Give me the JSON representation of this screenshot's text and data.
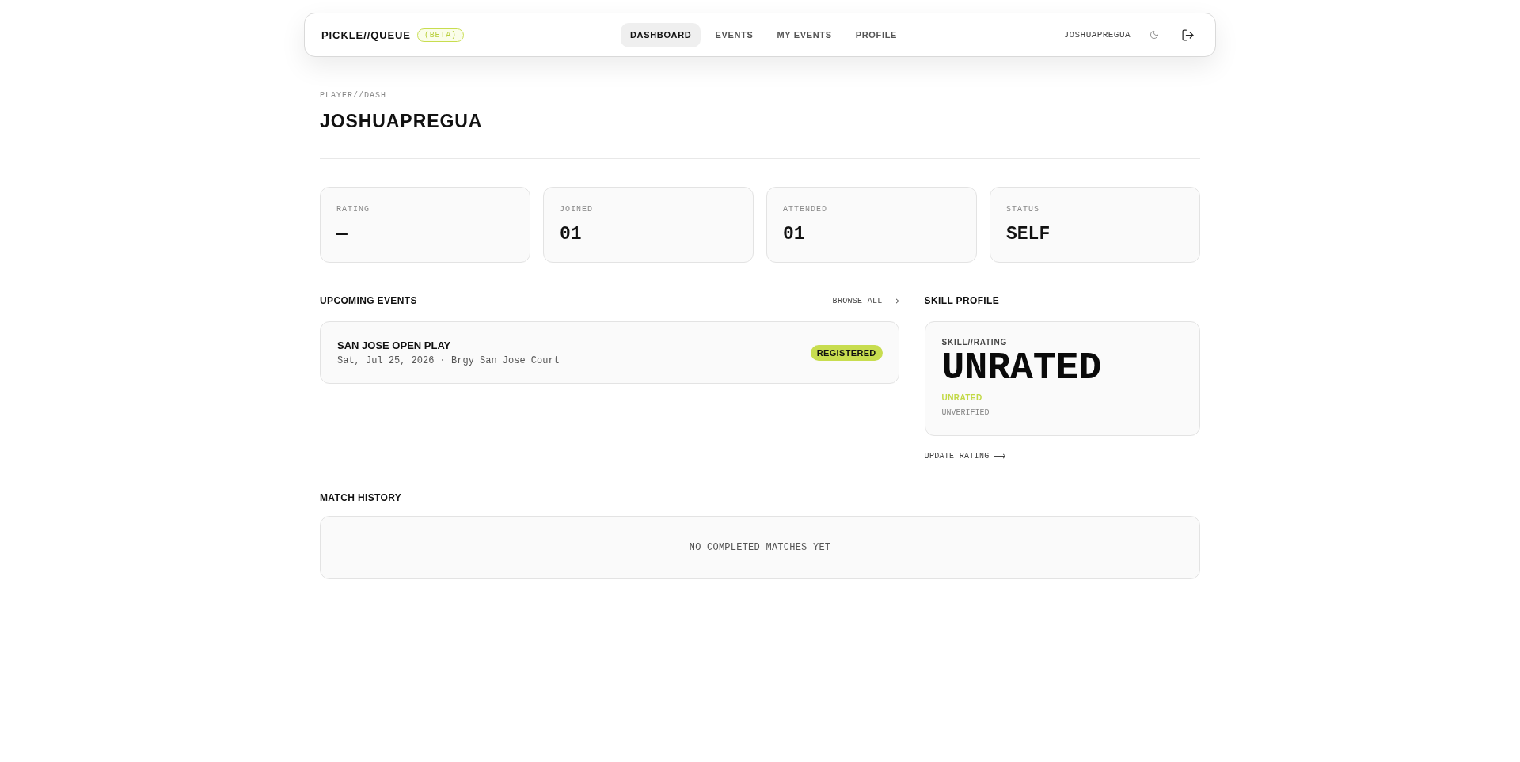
{
  "header": {
    "logo": "PICKLE//QUEUE",
    "badge": "(BETA)",
    "nav": [
      {
        "label": "DASHBOARD",
        "selected": true
      },
      {
        "label": "EVENTS",
        "selected": false
      },
      {
        "label": "MY EVENTS",
        "selected": false
      },
      {
        "label": "PROFILE",
        "selected": false
      }
    ],
    "username": "JOSHUAPREGUA"
  },
  "page": {
    "eyebrow": "PLAYER//DASH",
    "title": "JOSHUAPREGUA"
  },
  "stats": [
    {
      "label": "RATING",
      "value": "—"
    },
    {
      "label": "JOINED",
      "value": "01"
    },
    {
      "label": "ATTENDED",
      "value": "01"
    },
    {
      "label": "STATUS",
      "value": "SELF"
    }
  ],
  "upcoming": {
    "title": "UPCOMING EVENTS",
    "link": "BROWSE ALL",
    "events": [
      {
        "name": "SAN JOSE OPEN PLAY",
        "details": "Sat, Jul 25, 2026 · Brgy San Jose Court",
        "status": "REGISTERED"
      }
    ]
  },
  "skill_profile": {
    "title": "SKILL PROFILE",
    "label": "SKILL//RATING",
    "rating": "UNRATED",
    "tier": "UNRATED",
    "verification": "UNVERIFIED",
    "link": "UPDATE RATING"
  },
  "match_history": {
    "title": "MATCH HISTORY",
    "empty_message": "NO COMPLETED MATCHES YET"
  }
}
